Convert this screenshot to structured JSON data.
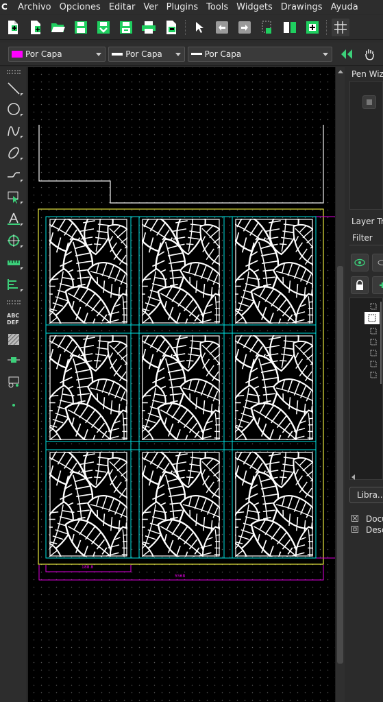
{
  "menubar": {
    "items": [
      "Archivo",
      "Opciones",
      "Editar",
      "Ver",
      "Plugins",
      "Tools",
      "Widgets",
      "Drawings",
      "Ayuda"
    ]
  },
  "toolbar": {
    "buttons": [
      "new-file-icon",
      "new-from-template-icon",
      "open-file-icon",
      "save-icon",
      "save-as-icon",
      "save-all-icon",
      "print-icon",
      "print-preview-icon",
      "select-pointer-icon",
      "undo-icon",
      "redo-icon",
      "copy-icon",
      "layers-icon",
      "block-insert-icon",
      "grid-icon"
    ]
  },
  "attributes": {
    "color": "Por Capa",
    "color_swatch": "#ff00ff",
    "line_width": "Por Capa",
    "line_type": "Por Capa"
  },
  "right_dock": {
    "pen_wizard_title": "Pen Wiza",
    "layer_tree_title": "Layer Tre",
    "filter_label": "Filter",
    "library_button": "Libra...",
    "doc_line1": "Docu",
    "doc_line2": "Desc"
  },
  "colors": {
    "accent_green": "#3cd07a",
    "canvas_bg": "#000000",
    "cyan": "#00e5e5",
    "magenta": "#e000e0",
    "yellow": "#e8e840",
    "white": "#ffffff"
  },
  "dimensions": {
    "panel_width_label": "188.8",
    "total_width_label": "5568"
  }
}
